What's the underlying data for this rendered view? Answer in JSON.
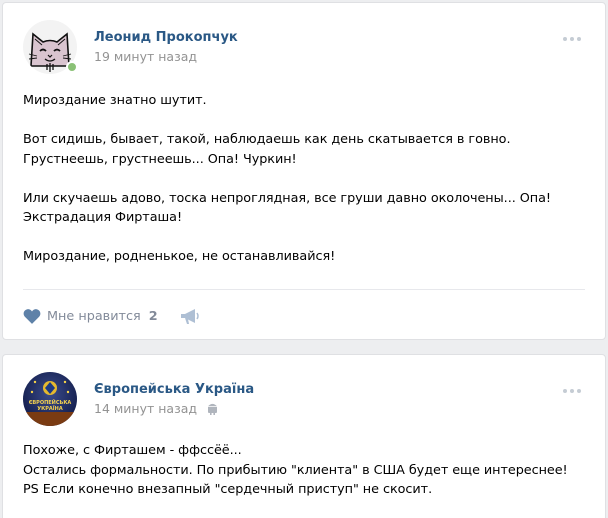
{
  "posts": [
    {
      "author": "Леонид Прокопчук",
      "time": "19 минут назад",
      "online": true,
      "lines": [
        "Мироздание знатно шутит.",
        "",
        "Вот сидишь, бывает, такой, наблюдаешь как день скатывается в говно.",
        "Грустнеешь, грустнеешь... Опа! Чуркин!",
        "",
        "Или скучаешь адово, тоска непроглядная, все груши давно околочены... Опа!",
        "Экстрадация Фирташа!",
        "",
        "Мироздание, родненькое, не останавливайся!"
      ],
      "like_label": "Мне нравится",
      "like_count": "2",
      "icons": {
        "like": "heart-icon",
        "share": "megaphone-icon",
        "more": "more-dots-icon"
      }
    },
    {
      "author": "Європейська Україна",
      "time": "14 минут назад",
      "platform_icon": "android-icon",
      "avatar_text": [
        "ЄВРОПЕЙСЬКА",
        "УКРАЇНА"
      ],
      "lines": [
        "Похоже, с Фирташем - ффссёё...",
        "Остались формальности. По прибытию \"клиента\" в США будет еще интереснее!",
        "PS Если конечно внезапный \"сердечный приступ\" не скосит."
      ]
    }
  ],
  "colors": {
    "link": "#2a5885",
    "meta": "#939393",
    "action": "#828a99",
    "background": "#edeef0",
    "online": "#8ac176"
  }
}
